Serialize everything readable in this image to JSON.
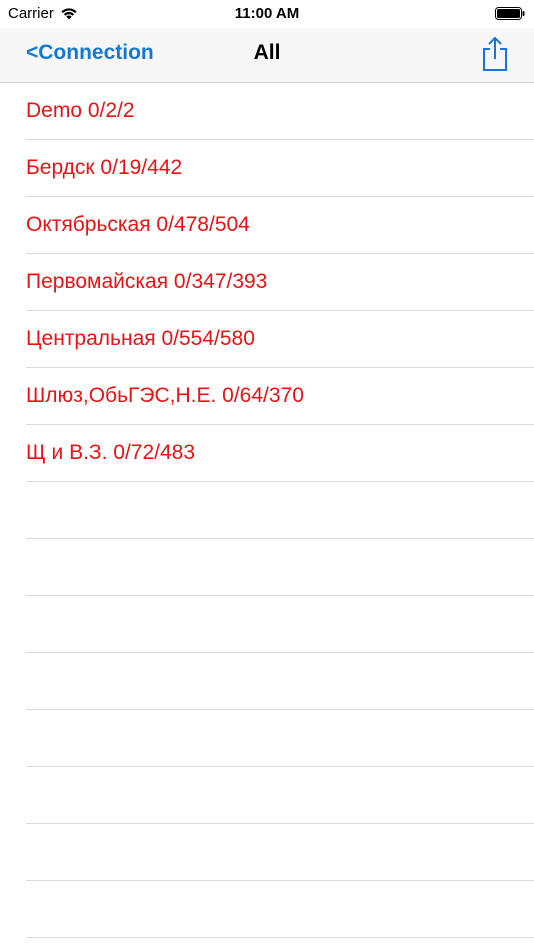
{
  "status_bar": {
    "carrier": "Carrier",
    "time": "11:00 AM"
  },
  "nav": {
    "back_label": "<Connection",
    "title": "All",
    "share_icon": "share-icon"
  },
  "colors": {
    "accent": "#1479d4",
    "item_text": "#ee1111"
  },
  "list": {
    "items": [
      {
        "label": "Demo 0/2/2"
      },
      {
        "label": "Бердск 0/19/442"
      },
      {
        "label": "Октябрьская 0/478/504"
      },
      {
        "label": "Первомайская 0/347/393"
      },
      {
        "label": "Центральная 0/554/580"
      },
      {
        "label": "Шлюз,ОбьГЭС,Н.Е. 0/64/370"
      },
      {
        "label": "Щ и В.З. 0/72/483"
      }
    ]
  }
}
